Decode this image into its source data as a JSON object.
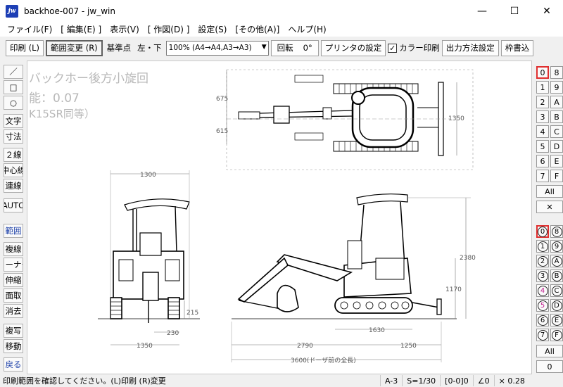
{
  "window": {
    "icon_text": "jw",
    "title": "backhoe-007 - jw_win",
    "minimize": "—",
    "maximize": "☐",
    "close": "✕"
  },
  "menu": [
    "ファイル(F)",
    "[ 編集(E) ]",
    "表示(V)",
    "[ 作図(D) ]",
    "設定(S)",
    "[その他(A)]",
    "ヘルプ(H)"
  ],
  "toolbar": {
    "print_label": "印刷 (L)",
    "range_change_label": "範囲変更 (R)",
    "base_point_label": "基準点",
    "base_point_value": "左・下",
    "scale_select_value": "100% (A4→A4,A3→A3)",
    "rotate_label": "回転",
    "rotate_value": "0°",
    "printer_settings_label": "プリンタの設定",
    "color_print_label": "カラー印刷",
    "color_print_checked": "✓",
    "output_method_label": "出力方法設定",
    "frame_label": "枠書込"
  },
  "left_tools": [
    "／",
    "□",
    "○",
    "文字",
    "寸法",
    "２線",
    "中心線",
    "連線",
    "AUTO",
    "範囲",
    "複線",
    "コーナー",
    "伸縮",
    "面取",
    "消去",
    "複写",
    "移動",
    "戻る"
  ],
  "right_layers_top": [
    "0",
    "8",
    "1",
    "9",
    "2",
    "A",
    "3",
    "B",
    "4",
    "C",
    "5",
    "D",
    "6",
    "E",
    "7",
    "F"
  ],
  "right_layers_bottom": [
    "0",
    "8",
    "1",
    "9",
    "2",
    "A",
    "3",
    "B",
    "4",
    "C",
    "5",
    "D",
    "6",
    "E",
    "7",
    "F"
  ],
  "right_all_label": "All",
  "right_x_label": "✕",
  "right_zero_label": "0",
  "canvas": {
    "title_lines": [
      "バックホー後方小旋回",
      "能：0.07",
      "K15SR同等）"
    ],
    "dimensions": {
      "d675": "675",
      "d615": "615",
      "d1350_side": "1350",
      "d1300": "1300",
      "d215": "215",
      "d230": "230",
      "d1350_front": "1350",
      "d2380": "2380",
      "d1170": "1170",
      "d1630": "1630",
      "d2790": "2790",
      "d1250": "1250",
      "d3600": "3600(ドーザ前の全長)"
    }
  },
  "status": {
    "message": "印刷範囲を確認してください。(L)印刷 (R)変更",
    "paper": "A-3",
    "scale": "S=1/30",
    "layer": "[0-0]0",
    "angle": "∠0",
    "zoom": "× 0.28"
  }
}
